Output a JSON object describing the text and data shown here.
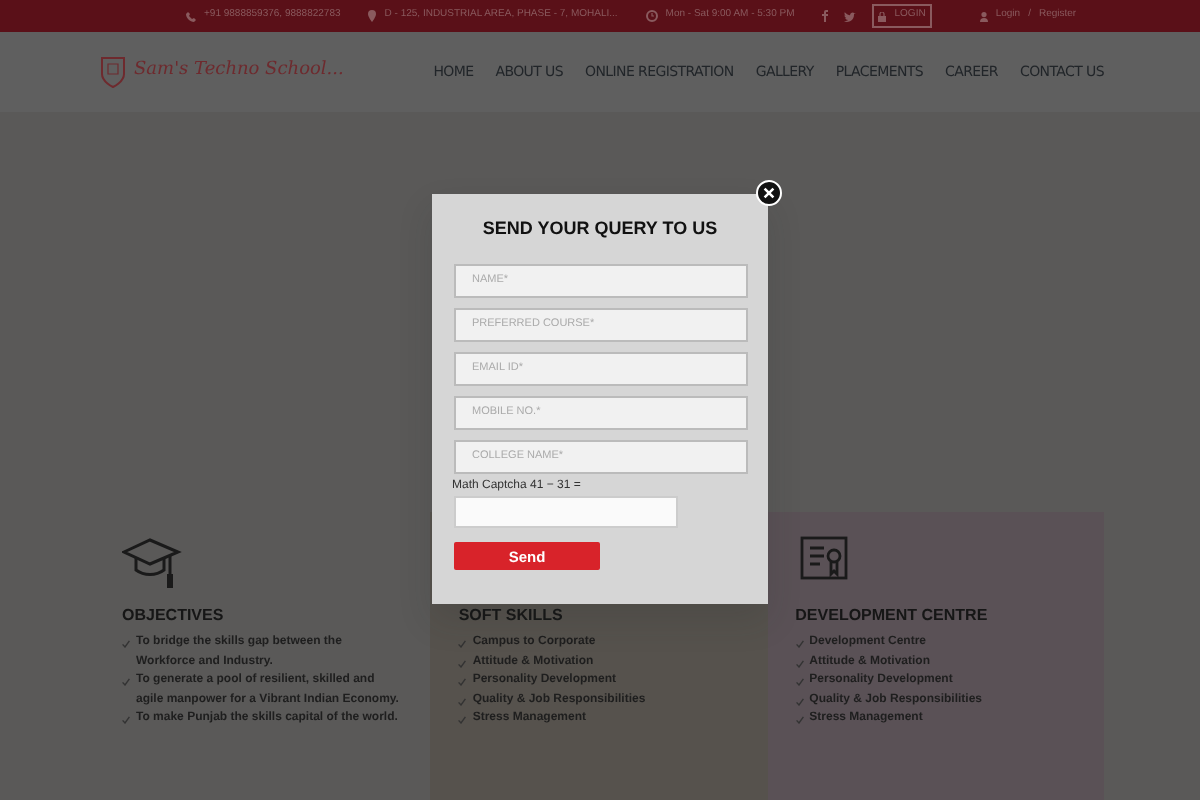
{
  "top_bar": {
    "phone": "+91 9888859376, 9888822783",
    "address": "D - 125, INDUSTRIAL AREA, PHASE - 7, MOHALI...",
    "hours": "Mon - Sat 9:00 AM - 5:30 PM",
    "login_button": "LOGIN",
    "login": "Login",
    "separator": "/",
    "register": "Register"
  },
  "header": {
    "logo_text": "Sam's Techno School...",
    "nav": [
      {
        "label": "HOME"
      },
      {
        "label": "ABOUT US"
      },
      {
        "label": "ONLINE REGISTRATION"
      },
      {
        "label": "GALLERY"
      },
      {
        "label": "PLACEMENTS"
      },
      {
        "label": "CAREER"
      },
      {
        "label": "CONTACT US"
      }
    ]
  },
  "cards": [
    {
      "kind": "cap",
      "title": "OBJECTIVES",
      "items": [
        "To bridge the skills gap between the Workforce and Industry.",
        "To generate a pool of resilient, skilled and agile manpower for a Vibrant Indian Economy.",
        "To make Punjab the skills capital of the world."
      ]
    },
    {
      "kind": "none",
      "title": "SOFT SKILLS",
      "items": [
        "Campus to Corporate",
        "Attitude & Motivation",
        "Personality Development",
        "Quality & Job Responsibilities",
        "Stress Management"
      ]
    },
    {
      "kind": "certificate",
      "title": "DEVELOPMENT CENTRE",
      "items": [
        "Development Centre",
        "Attitude & Motivation",
        "Personality Development",
        "Quality & Job Responsibilities",
        "Stress Management"
      ]
    }
  ],
  "modal": {
    "title": "SEND YOUR QUERY TO US",
    "fields": [
      {
        "placeholder": "NAME*"
      },
      {
        "placeholder": "PREFERRED COURSE*"
      },
      {
        "placeholder": "EMAIL ID*"
      },
      {
        "placeholder": "MOBILE NO.*"
      },
      {
        "placeholder": "COLLEGE NAME*"
      }
    ],
    "captcha_label": "Math Captcha 41 − 31 =",
    "submit": "Send"
  }
}
